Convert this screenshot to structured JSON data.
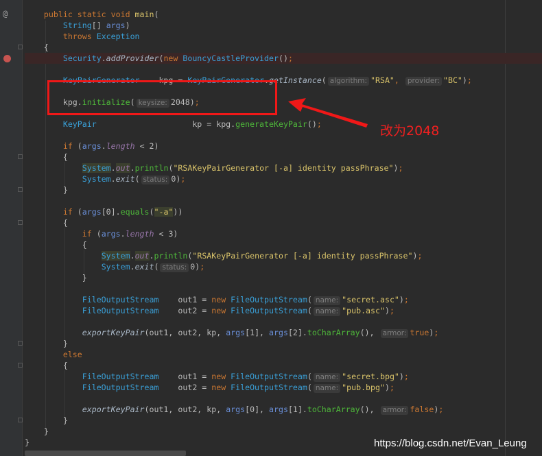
{
  "editor": {
    "gutter": {
      "override_marker": "@",
      "breakpoint_line": 5
    },
    "colors": {
      "background": "#2b2b2b",
      "keyword": "#cc7832",
      "type": "#3aa0d8",
      "method": "#4eb83a",
      "string": "#d9c36a",
      "annotation_red": "#f01818"
    },
    "lines": [
      [
        [
          "    public static void ",
          "kw"
        ],
        [
          "main",
          "st"
        ],
        [
          "(",
          "pl"
        ]
      ],
      [
        [
          "        ",
          "pl"
        ],
        [
          "String",
          "ty"
        ],
        [
          "[] ",
          "pl"
        ],
        [
          "args",
          "pa"
        ],
        [
          ")",
          "pl"
        ]
      ],
      [
        [
          "        ",
          "pl"
        ],
        [
          "throws ",
          "kw"
        ],
        [
          "Exception",
          "ty"
        ]
      ],
      [
        [
          "    {",
          "pl"
        ]
      ],
      [
        [
          "        ",
          "pl"
        ],
        [
          "Security",
          "ty"
        ],
        [
          ".",
          "pl"
        ],
        [
          "addProvider",
          "it"
        ],
        [
          "(",
          "pl"
        ],
        [
          "new ",
          "kw"
        ],
        [
          "BouncyCastleProvider",
          "ty"
        ],
        [
          "()",
          ""
        ],
        [
          ";",
          "sm"
        ]
      ],
      [],
      [
        [
          "        ",
          "pl"
        ],
        [
          "KeyPairGenerator",
          "ty"
        ],
        [
          "    kpg = ",
          "pl"
        ],
        [
          "KeyPairGenerator",
          "ty"
        ],
        [
          ".",
          "pl"
        ],
        [
          "getInstance",
          "it"
        ],
        [
          "(",
          "pl"
        ],
        [
          "algorithm:",
          "hint"
        ],
        [
          "\"RSA\"",
          "st"
        ],
        [
          ", ",
          "sm"
        ],
        [
          "provider:",
          "hint"
        ],
        [
          "\"BC\"",
          "st"
        ],
        [
          ")",
          "pl"
        ],
        [
          ";",
          "sm"
        ]
      ],
      [],
      [
        [
          "        kpg.",
          "pl"
        ],
        [
          "initialize",
          "me"
        ],
        [
          "(",
          "pl"
        ],
        [
          "keysize:",
          "hint"
        ],
        [
          "2048",
          "pl"
        ],
        [
          ")",
          "pl"
        ],
        [
          ";",
          "sm"
        ]
      ],
      [],
      [
        [
          "        ",
          "pl"
        ],
        [
          "KeyPair",
          "ty"
        ],
        [
          "                    kp = kpg.",
          "pl"
        ],
        [
          "generateKeyPair",
          "me"
        ],
        [
          "()",
          "pl"
        ],
        [
          ";",
          "sm"
        ]
      ],
      [],
      [
        [
          "        ",
          "pl"
        ],
        [
          "if ",
          "kw"
        ],
        [
          "(",
          "pl"
        ],
        [
          "args",
          "pa"
        ],
        [
          ".",
          "pl"
        ],
        [
          "length ",
          "fld"
        ],
        [
          "< 2)",
          "pl"
        ]
      ],
      [
        [
          "        {",
          "pl"
        ]
      ],
      [
        [
          "            ",
          "pl"
        ],
        [
          "System",
          "ty hl"
        ],
        [
          ".",
          "pl"
        ],
        [
          "out",
          "fld hl"
        ],
        [
          ".",
          "pl"
        ],
        [
          "println",
          "me"
        ],
        [
          "(",
          "pl"
        ],
        [
          "\"RSAKeyPairGenerator [-a] identity passPhrase\"",
          "st"
        ],
        [
          ")",
          "pl"
        ],
        [
          ";",
          "sm"
        ]
      ],
      [
        [
          "            ",
          "pl"
        ],
        [
          "System",
          "ty"
        ],
        [
          ".",
          "pl"
        ],
        [
          "exit",
          "it"
        ],
        [
          "(",
          "pl"
        ],
        [
          "status:",
          "hint"
        ],
        [
          "0",
          "pl"
        ],
        [
          ")",
          "pl"
        ],
        [
          ";",
          "sm"
        ]
      ],
      [
        [
          "        }",
          "pl"
        ]
      ],
      [],
      [
        [
          "        ",
          "pl"
        ],
        [
          "if ",
          "kw"
        ],
        [
          "(",
          "pl"
        ],
        [
          "args",
          "pa"
        ],
        [
          "[0].",
          "pl"
        ],
        [
          "equals",
          "me"
        ],
        [
          "(",
          "pl"
        ],
        [
          "\"-a\"",
          "st hl"
        ],
        [
          "))",
          "pl"
        ]
      ],
      [
        [
          "        {",
          "pl"
        ]
      ],
      [
        [
          "            ",
          "pl"
        ],
        [
          "if ",
          "kw"
        ],
        [
          "(",
          "pl"
        ],
        [
          "args",
          "pa"
        ],
        [
          ".",
          "pl"
        ],
        [
          "length ",
          "fld"
        ],
        [
          "< 3)",
          "pl"
        ]
      ],
      [
        [
          "            {",
          "pl"
        ]
      ],
      [
        [
          "                ",
          "pl"
        ],
        [
          "System",
          "ty hl"
        ],
        [
          ".",
          "pl"
        ],
        [
          "out",
          "fld hl"
        ],
        [
          ".",
          "pl"
        ],
        [
          "println",
          "me"
        ],
        [
          "(",
          "pl"
        ],
        [
          "\"RSAKeyPairGenerator [-a] identity passPhrase\"",
          "st"
        ],
        [
          ")",
          "pl"
        ],
        [
          ";",
          "sm"
        ]
      ],
      [
        [
          "                ",
          "pl"
        ],
        [
          "System",
          "ty"
        ],
        [
          ".",
          "pl"
        ],
        [
          "exit",
          "it"
        ],
        [
          "(",
          "pl"
        ],
        [
          "status:",
          "hint"
        ],
        [
          "0",
          "pl"
        ],
        [
          ")",
          "pl"
        ],
        [
          ";",
          "sm"
        ]
      ],
      [
        [
          "            }",
          "pl"
        ]
      ],
      [],
      [
        [
          "            ",
          "pl"
        ],
        [
          "FileOutputStream",
          "ty"
        ],
        [
          "    out1 = ",
          "pl"
        ],
        [
          "new ",
          "kw"
        ],
        [
          "FileOutputStream",
          "ty"
        ],
        [
          "(",
          "pl"
        ],
        [
          "name:",
          "hint"
        ],
        [
          "\"secret.asc\"",
          "st"
        ],
        [
          ")",
          "pl"
        ],
        [
          ";",
          "sm"
        ]
      ],
      [
        [
          "            ",
          "pl"
        ],
        [
          "FileOutputStream",
          "ty"
        ],
        [
          "    out2 = ",
          "pl"
        ],
        [
          "new ",
          "kw"
        ],
        [
          "FileOutputStream",
          "ty"
        ],
        [
          "(",
          "pl"
        ],
        [
          "name:",
          "hint"
        ],
        [
          "\"pub.asc\"",
          "st"
        ],
        [
          ")",
          "pl"
        ],
        [
          ";",
          "sm"
        ]
      ],
      [],
      [
        [
          "            ",
          "pl"
        ],
        [
          "exportKeyPair",
          "it"
        ],
        [
          "(out1, out2, kp, ",
          "pl"
        ],
        [
          "args",
          "pa"
        ],
        [
          "[1], ",
          "pl"
        ],
        [
          "args",
          "pa"
        ],
        [
          "[2].",
          "pl"
        ],
        [
          "toCharArray",
          "me"
        ],
        [
          "(), ",
          "pl"
        ],
        [
          "armor:",
          "hint"
        ],
        [
          "true",
          "kw"
        ],
        [
          ")",
          "pl"
        ],
        [
          ";",
          "sm"
        ]
      ],
      [
        [
          "        }",
          "pl"
        ]
      ],
      [
        [
          "        ",
          "pl"
        ],
        [
          "else",
          "kw"
        ]
      ],
      [
        [
          "        {",
          "pl"
        ]
      ],
      [
        [
          "            ",
          "pl"
        ],
        [
          "FileOutputStream",
          "ty"
        ],
        [
          "    out1 = ",
          "pl"
        ],
        [
          "new ",
          "kw"
        ],
        [
          "FileOutputStream",
          "ty"
        ],
        [
          "(",
          "pl"
        ],
        [
          "name:",
          "hint"
        ],
        [
          "\"secret.bpg\"",
          "st"
        ],
        [
          ")",
          "pl"
        ],
        [
          ";",
          "sm"
        ]
      ],
      [
        [
          "            ",
          "pl"
        ],
        [
          "FileOutputStream",
          "ty"
        ],
        [
          "    out2 = ",
          "pl"
        ],
        [
          "new ",
          "kw"
        ],
        [
          "FileOutputStream",
          "ty"
        ],
        [
          "(",
          "pl"
        ],
        [
          "name:",
          "hint"
        ],
        [
          "\"pub.bpg\"",
          "st"
        ],
        [
          ")",
          "pl"
        ],
        [
          ";",
          "sm"
        ]
      ],
      [],
      [
        [
          "            ",
          "pl"
        ],
        [
          "exportKeyPair",
          "it"
        ],
        [
          "(out1, out2, kp, ",
          "pl"
        ],
        [
          "args",
          "pa"
        ],
        [
          "[0], ",
          "pl"
        ],
        [
          "args",
          "pa"
        ],
        [
          "[1].",
          "pl"
        ],
        [
          "toCharArray",
          "me"
        ],
        [
          "(), ",
          "pl"
        ],
        [
          "armor:",
          "hint"
        ],
        [
          "false",
          "kw"
        ],
        [
          ")",
          "pl"
        ],
        [
          ";",
          "sm"
        ]
      ],
      [
        [
          "        }",
          "pl"
        ]
      ],
      [
        [
          "    }",
          "pl"
        ]
      ],
      [
        [
          "}",
          "pl"
        ]
      ]
    ]
  },
  "annotation": {
    "note": "改为2048"
  },
  "watermark": "https://blog.csdn.net/Evan_Leung"
}
